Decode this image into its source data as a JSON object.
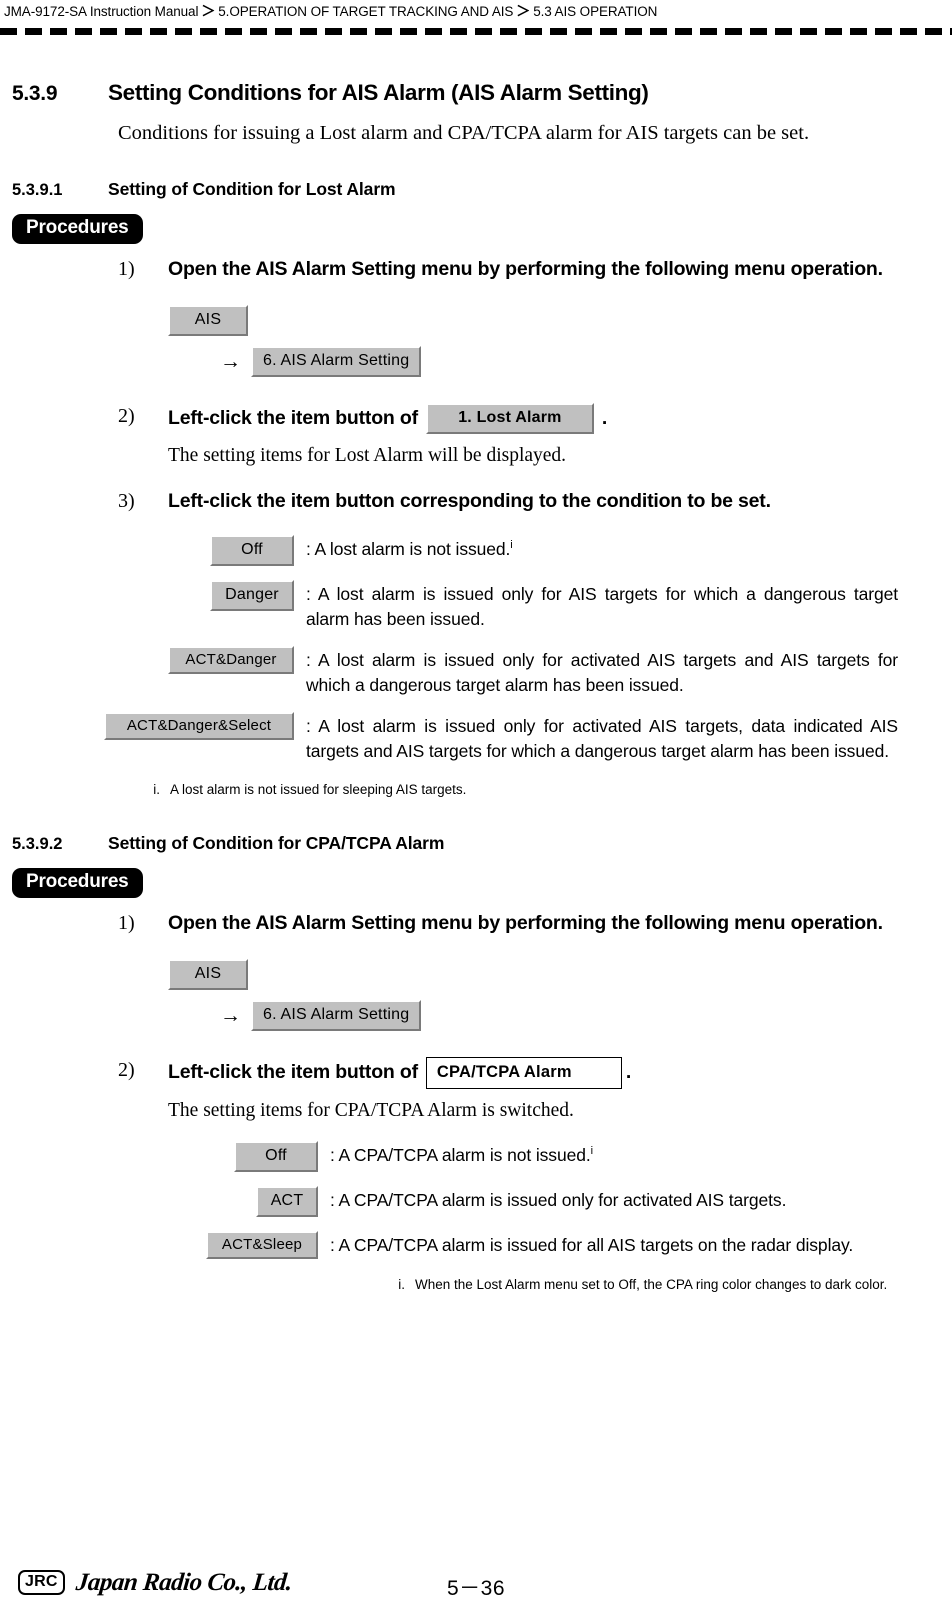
{
  "header": {
    "manual": "JMA-9172-SA Instruction Manual",
    "separator": "＞",
    "chapter": "5.OPERATION OF TARGET TRACKING AND AIS",
    "section": "5.3  AIS OPERATION"
  },
  "section": {
    "number": "5.3.9",
    "title": "Setting Conditions for AIS Alarm (AIS Alarm Setting)",
    "lead": "Conditions for issuing a Lost alarm and CPA/TCPA alarm for AIS targets can be set."
  },
  "subsection_1": {
    "number": "5.3.9.1",
    "title": "Setting of Condition for Lost Alarm",
    "procedures_label": "Procedures",
    "steps": [
      {
        "marker": "1)",
        "text": "Open the AIS Alarm Setting menu by performing the following menu operation."
      },
      {
        "marker": "2)",
        "text_before": "Left-click the item button of",
        "chip": "1. Lost Alarm",
        "text_after": ".",
        "note": "The setting items for Lost Alarm will be displayed."
      },
      {
        "marker": "3)",
        "text": "Left-click the item button corresponding to the condition to be set."
      }
    ],
    "menu_path": {
      "root_button": "AIS",
      "arrow": "→",
      "child_button": "6. AIS Alarm Setting"
    },
    "options": [
      {
        "chip": "Off",
        "chip_width": 84,
        "desc": ": A lost alarm is not issued.",
        "footnote_mark": "i"
      },
      {
        "chip": "Danger",
        "chip_width": 84,
        "desc": ": A lost alarm is issued only for AIS targets for which a dangerous target alarm has been issued.",
        "footnote_mark": ""
      },
      {
        "chip": "ACT&Danger",
        "chip_width": 126,
        "desc": ": A lost alarm is issued only for activated AIS targets and AIS targets for which a dangerous target alarm has been issued.",
        "footnote_mark": ""
      },
      {
        "chip": "ACT&Danger&Select",
        "chip_width": 190,
        "desc": ": A lost alarm is issued only for activated AIS targets, data indicated AIS targets and AIS targets for which a dangerous target alarm has been issued.",
        "footnote_mark": ""
      }
    ],
    "footnote": {
      "mark": "i.",
      "text": "A lost alarm is not issued for sleeping AIS targets."
    }
  },
  "subsection_2": {
    "number": "5.3.9.2",
    "title": "Setting of Condition for CPA/TCPA Alarm",
    "procedures_label": "Procedures",
    "steps": [
      {
        "marker": "1)",
        "text": "Open the AIS Alarm Setting menu by performing the following menu operation."
      },
      {
        "marker": "2)",
        "text_before": "Left-click the item button of",
        "chip": "CPA/TCPA Alarm",
        "text_after": ".",
        "note": "The setting items for CPA/TCPA Alarm is switched."
      }
    ],
    "menu_path": {
      "root_button": "AIS",
      "arrow": "→",
      "child_button": "6. AIS Alarm Setting"
    },
    "options": [
      {
        "chip": "Off",
        "chip_width": 84,
        "desc": ": A CPA/TCPA alarm is not issued.",
        "footnote_mark": "i"
      },
      {
        "chip": "ACT",
        "chip_width": 62,
        "desc": ": A CPA/TCPA alarm is issued only for activated AIS targets.",
        "footnote_mark": ""
      },
      {
        "chip": "ACT&Sleep",
        "chip_width": 112,
        "desc": ": A CPA/TCPA alarm is issued for all AIS targets on the radar display.",
        "footnote_mark": ""
      }
    ],
    "footnote": {
      "mark": "i.",
      "text": "When the Lost Alarm menu set to Off, the CPA ring color changes to dark color."
    }
  },
  "footer": {
    "logo_mark": "JRC",
    "logo_text": "Japan Radio Co., Ltd.",
    "page_number": "5－36"
  }
}
